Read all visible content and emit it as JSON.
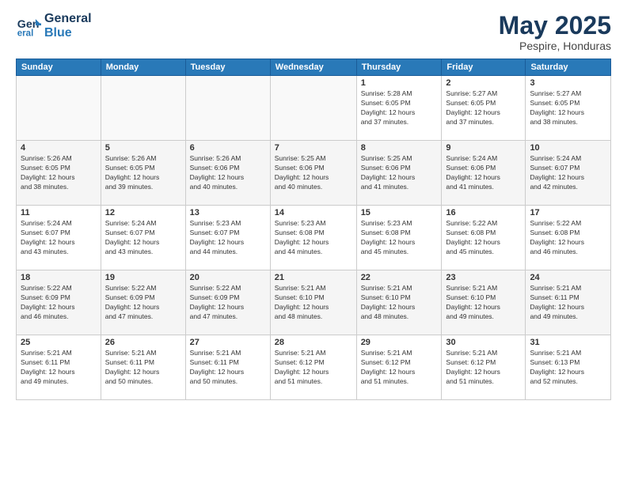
{
  "header": {
    "logo_line1": "General",
    "logo_line2": "Blue",
    "month": "May 2025",
    "location": "Pespire, Honduras"
  },
  "weekdays": [
    "Sunday",
    "Monday",
    "Tuesday",
    "Wednesday",
    "Thursday",
    "Friday",
    "Saturday"
  ],
  "weeks": [
    [
      {
        "day": "",
        "info": ""
      },
      {
        "day": "",
        "info": ""
      },
      {
        "day": "",
        "info": ""
      },
      {
        "day": "",
        "info": ""
      },
      {
        "day": "1",
        "info": "Sunrise: 5:28 AM\nSunset: 6:05 PM\nDaylight: 12 hours\nand 37 minutes."
      },
      {
        "day": "2",
        "info": "Sunrise: 5:27 AM\nSunset: 6:05 PM\nDaylight: 12 hours\nand 37 minutes."
      },
      {
        "day": "3",
        "info": "Sunrise: 5:27 AM\nSunset: 6:05 PM\nDaylight: 12 hours\nand 38 minutes."
      }
    ],
    [
      {
        "day": "4",
        "info": "Sunrise: 5:26 AM\nSunset: 6:05 PM\nDaylight: 12 hours\nand 38 minutes."
      },
      {
        "day": "5",
        "info": "Sunrise: 5:26 AM\nSunset: 6:05 PM\nDaylight: 12 hours\nand 39 minutes."
      },
      {
        "day": "6",
        "info": "Sunrise: 5:26 AM\nSunset: 6:06 PM\nDaylight: 12 hours\nand 40 minutes."
      },
      {
        "day": "7",
        "info": "Sunrise: 5:25 AM\nSunset: 6:06 PM\nDaylight: 12 hours\nand 40 minutes."
      },
      {
        "day": "8",
        "info": "Sunrise: 5:25 AM\nSunset: 6:06 PM\nDaylight: 12 hours\nand 41 minutes."
      },
      {
        "day": "9",
        "info": "Sunrise: 5:24 AM\nSunset: 6:06 PM\nDaylight: 12 hours\nand 41 minutes."
      },
      {
        "day": "10",
        "info": "Sunrise: 5:24 AM\nSunset: 6:07 PM\nDaylight: 12 hours\nand 42 minutes."
      }
    ],
    [
      {
        "day": "11",
        "info": "Sunrise: 5:24 AM\nSunset: 6:07 PM\nDaylight: 12 hours\nand 43 minutes."
      },
      {
        "day": "12",
        "info": "Sunrise: 5:24 AM\nSunset: 6:07 PM\nDaylight: 12 hours\nand 43 minutes."
      },
      {
        "day": "13",
        "info": "Sunrise: 5:23 AM\nSunset: 6:07 PM\nDaylight: 12 hours\nand 44 minutes."
      },
      {
        "day": "14",
        "info": "Sunrise: 5:23 AM\nSunset: 6:08 PM\nDaylight: 12 hours\nand 44 minutes."
      },
      {
        "day": "15",
        "info": "Sunrise: 5:23 AM\nSunset: 6:08 PM\nDaylight: 12 hours\nand 45 minutes."
      },
      {
        "day": "16",
        "info": "Sunrise: 5:22 AM\nSunset: 6:08 PM\nDaylight: 12 hours\nand 45 minutes."
      },
      {
        "day": "17",
        "info": "Sunrise: 5:22 AM\nSunset: 6:08 PM\nDaylight: 12 hours\nand 46 minutes."
      }
    ],
    [
      {
        "day": "18",
        "info": "Sunrise: 5:22 AM\nSunset: 6:09 PM\nDaylight: 12 hours\nand 46 minutes."
      },
      {
        "day": "19",
        "info": "Sunrise: 5:22 AM\nSunset: 6:09 PM\nDaylight: 12 hours\nand 47 minutes."
      },
      {
        "day": "20",
        "info": "Sunrise: 5:22 AM\nSunset: 6:09 PM\nDaylight: 12 hours\nand 47 minutes."
      },
      {
        "day": "21",
        "info": "Sunrise: 5:21 AM\nSunset: 6:10 PM\nDaylight: 12 hours\nand 48 minutes."
      },
      {
        "day": "22",
        "info": "Sunrise: 5:21 AM\nSunset: 6:10 PM\nDaylight: 12 hours\nand 48 minutes."
      },
      {
        "day": "23",
        "info": "Sunrise: 5:21 AM\nSunset: 6:10 PM\nDaylight: 12 hours\nand 49 minutes."
      },
      {
        "day": "24",
        "info": "Sunrise: 5:21 AM\nSunset: 6:11 PM\nDaylight: 12 hours\nand 49 minutes."
      }
    ],
    [
      {
        "day": "25",
        "info": "Sunrise: 5:21 AM\nSunset: 6:11 PM\nDaylight: 12 hours\nand 49 minutes."
      },
      {
        "day": "26",
        "info": "Sunrise: 5:21 AM\nSunset: 6:11 PM\nDaylight: 12 hours\nand 50 minutes."
      },
      {
        "day": "27",
        "info": "Sunrise: 5:21 AM\nSunset: 6:11 PM\nDaylight: 12 hours\nand 50 minutes."
      },
      {
        "day": "28",
        "info": "Sunrise: 5:21 AM\nSunset: 6:12 PM\nDaylight: 12 hours\nand 51 minutes."
      },
      {
        "day": "29",
        "info": "Sunrise: 5:21 AM\nSunset: 6:12 PM\nDaylight: 12 hours\nand 51 minutes."
      },
      {
        "day": "30",
        "info": "Sunrise: 5:21 AM\nSunset: 6:12 PM\nDaylight: 12 hours\nand 51 minutes."
      },
      {
        "day": "31",
        "info": "Sunrise: 5:21 AM\nSunset: 6:13 PM\nDaylight: 12 hours\nand 52 minutes."
      }
    ]
  ]
}
